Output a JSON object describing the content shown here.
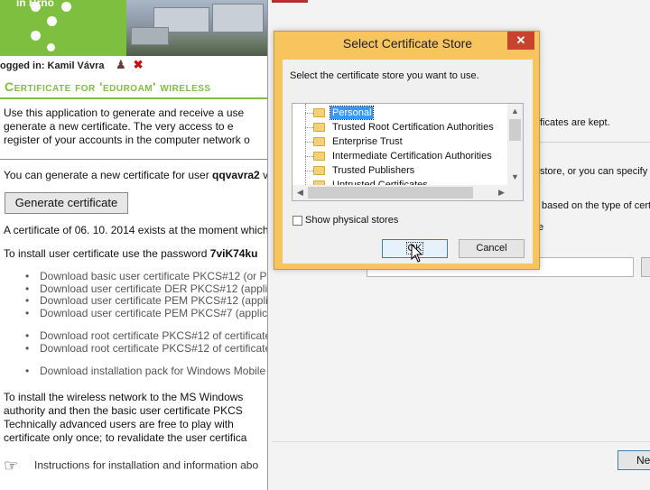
{
  "webpage": {
    "brand_fragment": "in Brno",
    "logged_in_label": "ogged in: Kamil Vávra",
    "heading": "Certificate for 'eduroam' wireless",
    "intro_lines": [
      "Use this application to generate and receive a use",
      "generate a new certificate. The very access to e",
      "register of your accounts in the computer network o"
    ],
    "generate_prefix": "You can generate a new certificate for user ",
    "generate_user": "qqvavra2",
    "generate_suffix": " v",
    "generate_button": "Generate certificate",
    "exists_line": "A certificate of 06. 10. 2014 exists at the moment which",
    "password_prefix": "To install user certificate use the password ",
    "password_value": "7viK74ku",
    "downloads": [
      "Download basic user certificate PKCS#12 (or P",
      "Download user certificate DER PKCS#12 (appli",
      "Download user certificate PEM PKCS#12 (appli",
      "Download user certificate PEM PKCS#7 (applic",
      "Download root certificate PKCS#12 of certificate",
      "Download root certificate PKCS#12 of certificate",
      "Download installation pack for Windows Mobile"
    ],
    "bottom_lines": [
      "To install the wireless network to the MS Windows",
      "authority and then the basic user certificate PKCS",
      "Technically advanced users are free to play with",
      "certificate only once; to revalidate the user certifica"
    ],
    "instructions": "Instructions for installation and information abo"
  },
  "wizard": {
    "text_kept": "ficates are kept.",
    "text_specify": "store, or you can specify a",
    "text_based": "based on the type of certi",
    "text_e": "e",
    "next_label": "Ne"
  },
  "dialog": {
    "title": "Select Certificate Store",
    "close_glyph": "✕",
    "prompt": "Select the certificate store you want to use.",
    "stores": [
      {
        "label": "Personal",
        "selected": true
      },
      {
        "label": "Trusted Root Certification Authorities",
        "selected": false
      },
      {
        "label": "Enterprise Trust",
        "selected": false
      },
      {
        "label": "Intermediate Certification Authorities",
        "selected": false
      },
      {
        "label": "Trusted Publishers",
        "selected": false
      },
      {
        "label": "Untrusted Certificates",
        "selected": false
      }
    ],
    "show_physical_label": "Show physical stores",
    "show_physical_checked": false,
    "ok_label": "OK",
    "cancel_label": "Cancel"
  },
  "colors": {
    "brand_green": "#7fbf3f",
    "dialog_frame": "#f7c45e",
    "close_red": "#c7432f",
    "selection_blue": "#3399ff"
  },
  "icons": [
    "user-icon",
    "logout-x-icon",
    "pointing-hand-icon",
    "folder-icon",
    "close-icon",
    "scroll-up-icon",
    "scroll-down-icon",
    "scroll-left-icon",
    "scroll-right-icon",
    "mouse-cursor-icon"
  ]
}
